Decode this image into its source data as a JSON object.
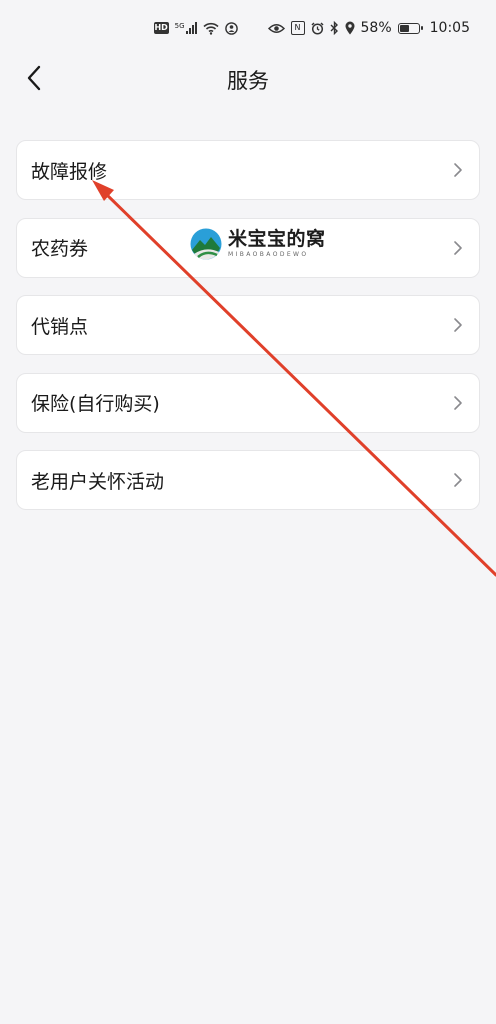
{
  "status_bar": {
    "hd_label": "HD",
    "network_label": "5G",
    "battery_percent_text": "58%",
    "battery_level": 0.58,
    "time": "10:05"
  },
  "header": {
    "title": "服务",
    "back_icon": "chevron-left-icon"
  },
  "menu": {
    "items": [
      {
        "label": "故障报修",
        "icon": "chevron-right-icon"
      },
      {
        "label": "农药券",
        "icon": "chevron-right-icon"
      },
      {
        "label": "代销点",
        "icon": "chevron-right-icon"
      },
      {
        "label": "保险(自行购买)",
        "icon": "chevron-right-icon"
      },
      {
        "label": "老用户关怀活动",
        "icon": "chevron-right-icon"
      }
    ]
  },
  "watermark": {
    "main": "米宝宝的窝",
    "sub": "MIBAOBAODEWO"
  },
  "colors": {
    "background": "#f5f5f7",
    "card": "#ffffff",
    "annotation_arrow": "#e0402a"
  }
}
